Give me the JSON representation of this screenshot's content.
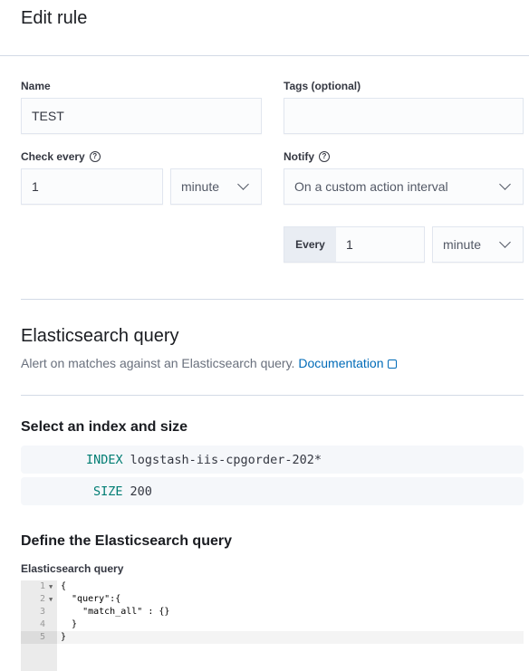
{
  "header": {
    "title": "Edit rule"
  },
  "form": {
    "name": {
      "label": "Name",
      "value": "TEST"
    },
    "tags": {
      "label": "Tags (optional)",
      "value": ""
    },
    "check_every": {
      "label": "Check every",
      "value": "1",
      "unit": "minute"
    },
    "notify": {
      "label": "Notify",
      "value": "On a custom action interval"
    },
    "action_interval": {
      "prepend": "Every",
      "value": "1",
      "unit": "minute"
    }
  },
  "rule_type": {
    "title": "Elasticsearch query",
    "description": "Alert on matches against an Elasticsearch query.",
    "doc_link": "Documentation"
  },
  "index_section": {
    "title": "Select an index and size",
    "index_keyword": "INDEX",
    "index_value": "logstash-iis-cpgorder-202*",
    "size_keyword": "SIZE",
    "size_value": "200"
  },
  "query_section": {
    "title": "Define the Elasticsearch query",
    "editor_label": "Elasticsearch query",
    "lines": [
      {
        "n": "1",
        "text": "{"
      },
      {
        "n": "2",
        "text": "  \"query\":{"
      },
      {
        "n": "3",
        "text": "    \"match_all\" : {}"
      },
      {
        "n": "4",
        "text": "  }"
      },
      {
        "n": "5",
        "text": "}"
      }
    ]
  },
  "colors": {
    "accent_link": "#006bb8",
    "keyword": "#017d73"
  }
}
